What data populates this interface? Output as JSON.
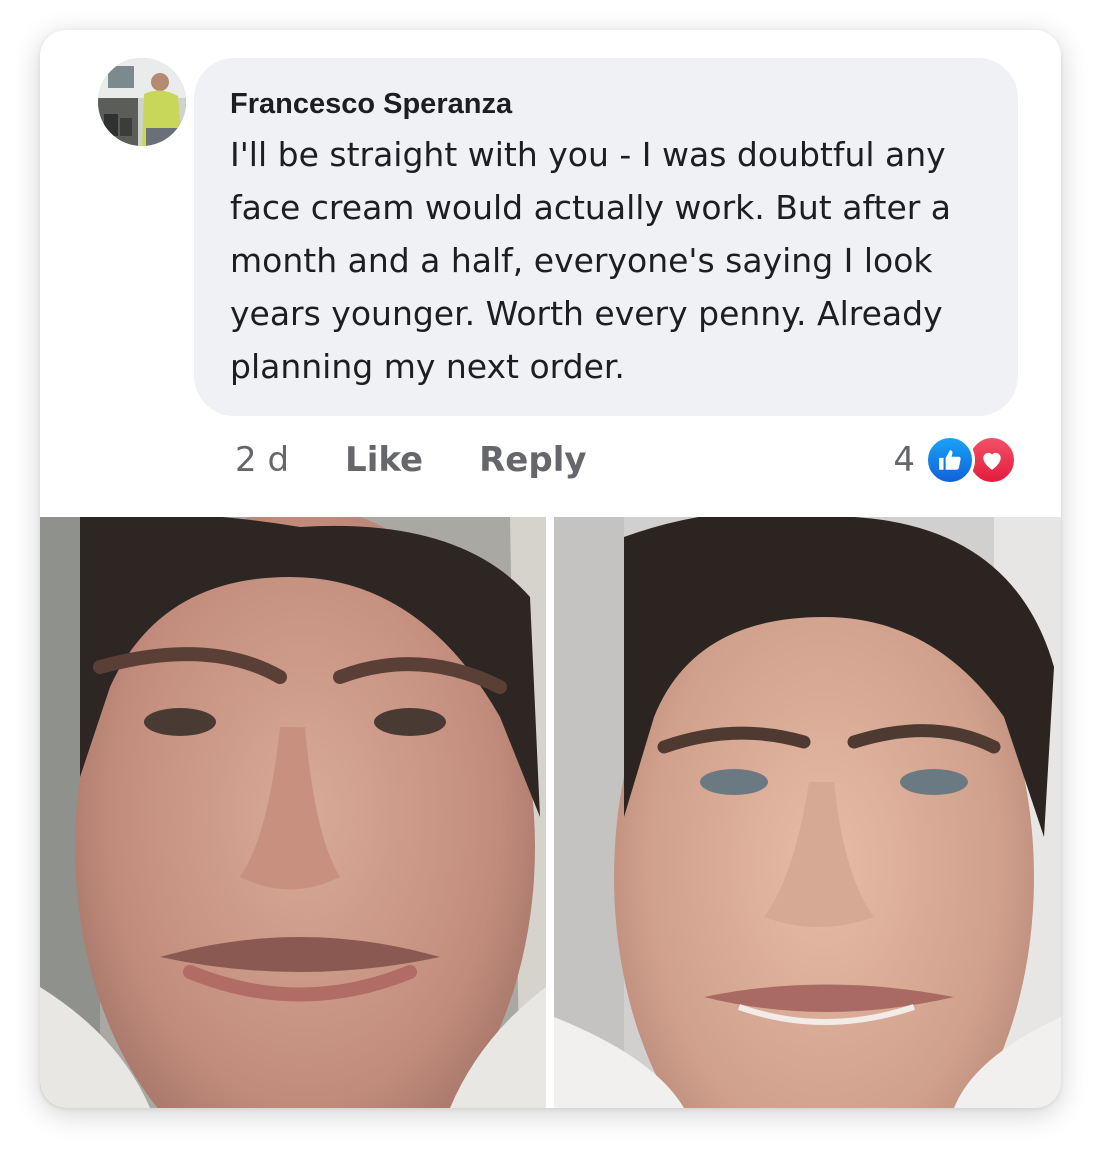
{
  "comment": {
    "author": "Francesco Speranza",
    "text": "I'll be straight with you - I was doubtful any face cream would actually work. But after a month and a half, everyone's saying I look years younger. Worth every penny. Already planning my next order.",
    "time": "2 d",
    "like_label": "Like",
    "reply_label": "Reply",
    "reaction_count": "4",
    "reaction_icons": [
      "like-icon",
      "love-icon"
    ]
  },
  "colors": {
    "bubble": "#eff1f5",
    "secondary_text": "#65676b",
    "like_blue": "#1877f2",
    "love_red": "#e41e3f"
  },
  "photos": [
    {
      "name": "before-photo",
      "description_icon": "face-photo"
    },
    {
      "name": "after-photo",
      "description_icon": "face-photo"
    }
  ]
}
